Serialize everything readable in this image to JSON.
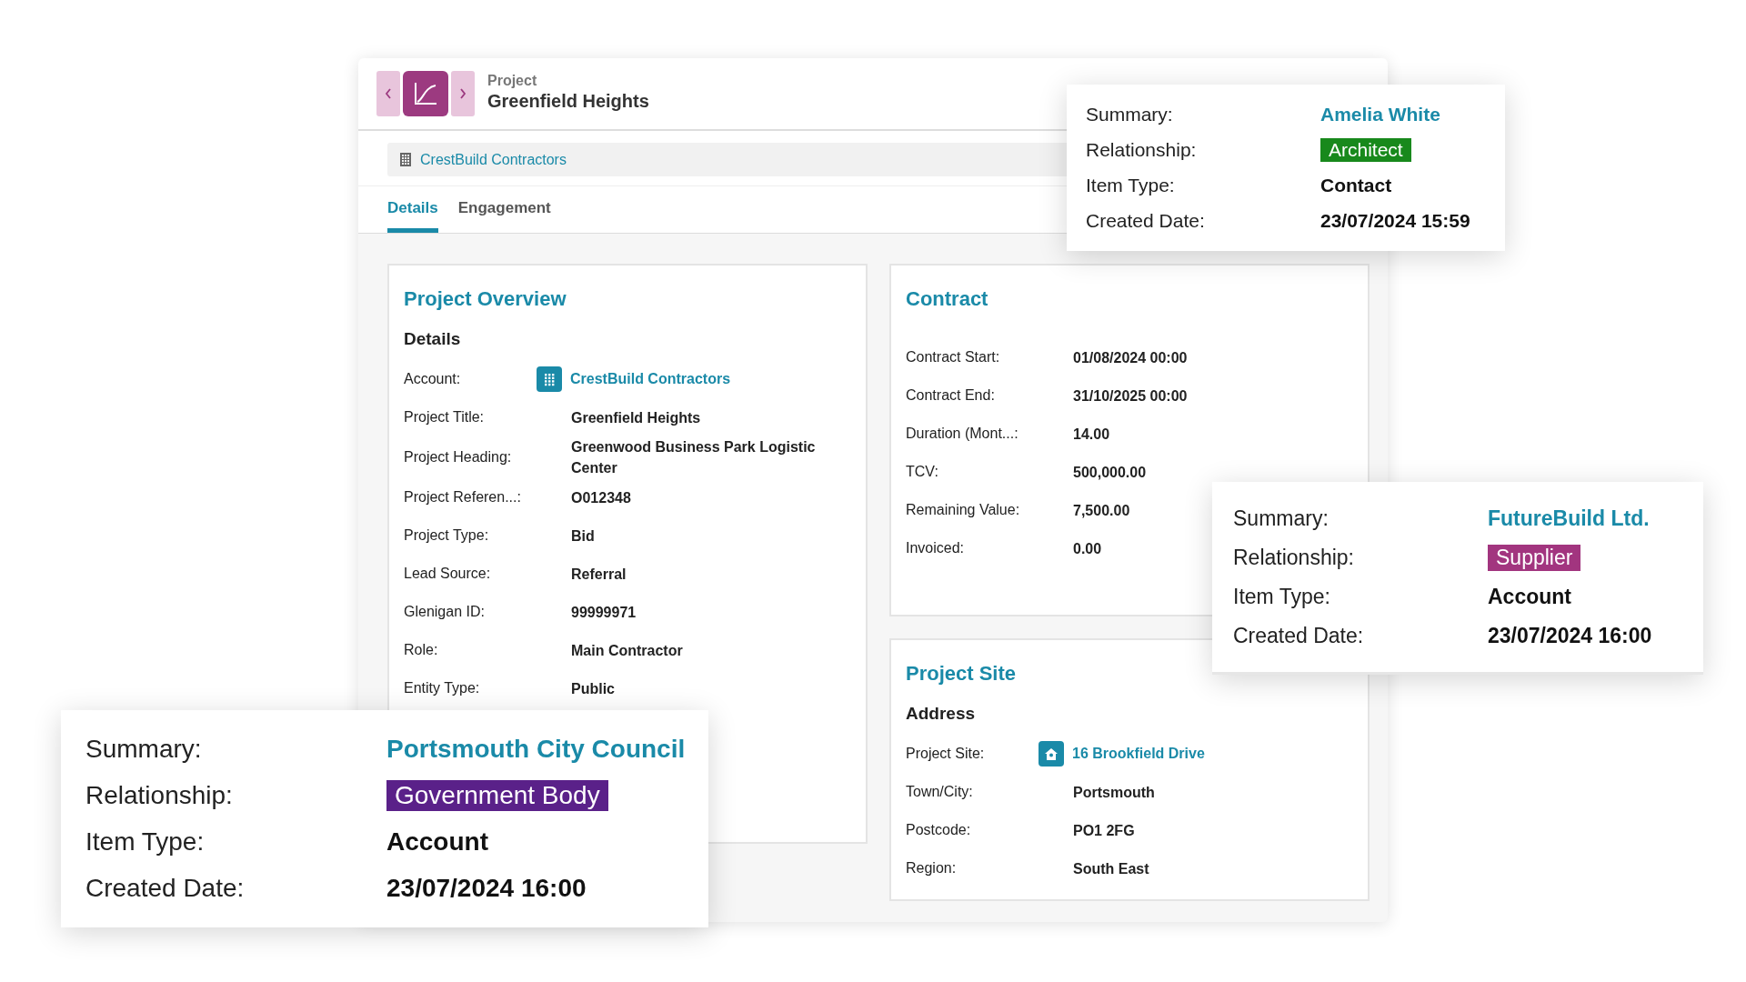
{
  "header": {
    "record_type": "Project",
    "title": "Greenfield Heights"
  },
  "account_bar": {
    "link": "CrestBuild Contractors"
  },
  "tabs": [
    {
      "label": "Details",
      "selected": true
    },
    {
      "label": "Engagement",
      "selected": false
    }
  ],
  "cards": [
    {
      "title": "Project Overview",
      "subtitle": "Details",
      "fields": [
        {
          "label": "Account:",
          "value": "CrestBuild Contractors",
          "kind": "account"
        },
        {
          "label": "Project Title:",
          "value": "Greenfield Heights",
          "kind": "text"
        },
        {
          "label": "Project Heading:",
          "value": "Greenwood Business Park Logistic Center",
          "kind": "text"
        },
        {
          "label": "Project Referen...:",
          "value": "O012348",
          "kind": "text"
        },
        {
          "label": "Project Type:",
          "value": "Bid",
          "kind": "text"
        },
        {
          "label": "Lead Source:",
          "value": "Referral",
          "kind": "text"
        },
        {
          "label": "Glenigan ID:",
          "value": "99999971",
          "kind": "text"
        },
        {
          "label": "Role:",
          "value": "Main Contractor",
          "kind": "text"
        },
        {
          "label": "Entity Type:",
          "value": "Public",
          "kind": "text"
        }
      ]
    },
    {
      "title": "Contract",
      "fields": [
        {
          "label": "Contract Start:",
          "value": "01/08/2024 00:00",
          "kind": "text"
        },
        {
          "label": "Contract End:",
          "value": "31/10/2025 00:00",
          "kind": "text"
        },
        {
          "label": "Duration (Mont...:",
          "value": "14.00",
          "kind": "text"
        },
        {
          "label": "TCV:",
          "value": "500,000.00",
          "kind": "text"
        },
        {
          "label": "Remaining Value:",
          "value": "7,500.00",
          "kind": "text"
        },
        {
          "label": "Invoiced:",
          "value": "0.00",
          "kind": "text"
        }
      ]
    },
    {
      "title": "Project Site",
      "subtitle": "Address",
      "fields": [
        {
          "label": "Project Site:",
          "value": "16 Brookfield Drive",
          "kind": "site"
        },
        {
          "label": "Town/City:",
          "value": "Portsmouth",
          "kind": "text"
        },
        {
          "label": "Postcode:",
          "value": "PO1 2FG",
          "kind": "text"
        },
        {
          "label": "Region:",
          "value": "South East",
          "kind": "text"
        }
      ]
    }
  ],
  "popups": [
    {
      "rows": [
        {
          "label": "Summary:",
          "value": "Amelia White",
          "kind": "link"
        },
        {
          "label": "Relationship:",
          "value": "Architect",
          "kind": "badge",
          "color": "#18891c"
        },
        {
          "label": "Item Type:",
          "value": "Contact",
          "kind": "text"
        },
        {
          "label": "Created Date:",
          "value": "23/07/2024 15:59",
          "kind": "text"
        }
      ]
    },
    {
      "rows": [
        {
          "label": "Summary:",
          "value": "FutureBuild Ltd.",
          "kind": "link"
        },
        {
          "label": "Relationship:",
          "value": "Supplier",
          "kind": "badge",
          "color": "#a2357f"
        },
        {
          "label": "Item Type:",
          "value": "Account",
          "kind": "text"
        },
        {
          "label": "Created Date:",
          "value": "23/07/2024 16:00",
          "kind": "text"
        }
      ]
    },
    {
      "rows": [
        {
          "label": "Summary:",
          "value": "Portsmouth City Council",
          "kind": "link"
        },
        {
          "label": "Relationship:",
          "value": "Government Body",
          "kind": "badge",
          "color": "#5a2189"
        },
        {
          "label": "Item Type:",
          "value": "Account",
          "kind": "text"
        },
        {
          "label": "Created Date:",
          "value": "23/07/2024 16:00",
          "kind": "text"
        }
      ]
    }
  ]
}
